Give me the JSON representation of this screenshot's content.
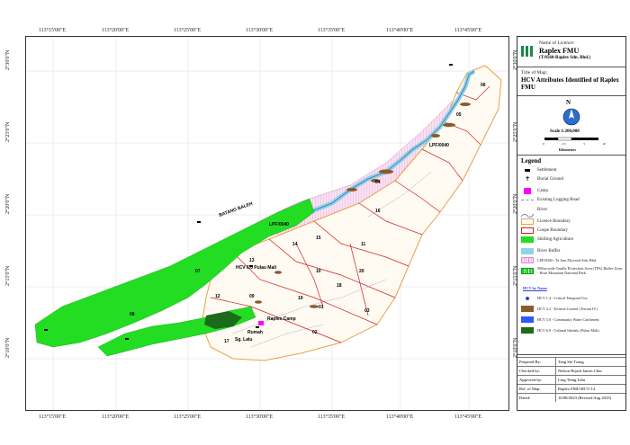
{
  "grid": {
    "top_ticks": [
      "113°15'00\"E",
      "113°20'00\"E",
      "113°25'00\"E",
      "113°30'00\"E",
      "113°35'00\"E",
      "113°40'00\"E",
      "113°45'00\"E"
    ],
    "left_ticks": [
      "2°30'0\"N",
      "2°25'0\"N",
      "2°20'0\"N",
      "2°15'0\"N",
      "2°10'0\"N"
    ]
  },
  "licence": {
    "heading": "Name of Licence:",
    "name": "Raplex FMU",
    "code": "(T/0560-Raplex Sdn. Bhd.)"
  },
  "title_block": {
    "heading": "Title of Map:",
    "title": "HCV Attributes Identified of Raplex FMU"
  },
  "north": {
    "letter": "N"
  },
  "scale": {
    "text": "Scale 1:200,000",
    "units": "Kilometers",
    "ticks": [
      "0",
      "2.5",
      "5",
      "10"
    ]
  },
  "legend": {
    "heading": "Legend",
    "items": [
      {
        "label": "Settlement",
        "icon": "settlement-icon"
      },
      {
        "label": "Burial Ground",
        "icon": "burial-icon"
      },
      {
        "label": "Camp",
        "icon": "camp-icon",
        "color": "#ff00ff"
      },
      {
        "label": "Existing Logging Road",
        "icon": "road-icon"
      },
      {
        "label": "River",
        "icon": "river-icon"
      },
      {
        "label": "Licence Boundary",
        "icon": "licence-boundary-icon",
        "color": "#e8a24a"
      },
      {
        "label": "Coupe Boundary",
        "icon": "coupe-boundary-icon",
        "color": "#d02020"
      },
      {
        "label": "Shifting Agriculture",
        "icon": "agriculture-icon",
        "color": "#22dd22"
      },
      {
        "label": "River Buffer",
        "icon": "river-buffer-icon",
        "color": "#8fd3e8"
      },
      {
        "label": "LPF/0040 - Ta Ann Plywood Sdn. Bhd.",
        "icon": "lpf-icon",
        "color": "#f4c0e8"
      },
      {
        "label": "500m-wide Totally Protection Area (TPA) Buffer Zone - Hose Mountain National Park",
        "icon": "tpa-icon",
        "color": "#22cc22"
      }
    ],
    "hcv_heading": "HCV by Name",
    "hcv_items": [
      {
        "label": "HCV 1.4 - Critical Temporal Use",
        "icon": "hcv14-icon",
        "color": "#3344cc"
      },
      {
        "label": "HCV 4.2 - Erosion Control (Terrain IV)",
        "icon": "hcv42-icon",
        "color": "#8b5a2b"
      },
      {
        "label": "HCV 5.0 - Community Water Catchment",
        "icon": "hcv50-icon",
        "color": "#3355ff"
      },
      {
        "label": "HCV 6.0 - Cultural Identity (Pulau Mali)",
        "icon": "hcv60-icon",
        "color": "#1b6b1b"
      }
    ]
  },
  "info": [
    {
      "key": "Prepared By:",
      "value": "Tang Sie Tzang"
    },
    {
      "key": "Checked by:",
      "value": "Nelson Bijack James Chin"
    },
    {
      "key": "Approved by:",
      "value": "Ling Tieng Lihu"
    },
    {
      "key": "Ref. of Map:",
      "value": "Raplex FMU/HCV/14"
    },
    {
      "key": "Dated:",
      "value": "10/08/2023 (Revised Aug 2023)"
    }
  ],
  "map_labels": {
    "lpf_label_1": "LPF/0040",
    "lpf_label_2": "LPF/0040",
    "river_name": "BATANG BALEH",
    "coupes": [
      "06",
      "05",
      "04",
      "16",
      "15",
      "14",
      "13",
      "11",
      "10",
      "09",
      "20",
      "12",
      "07",
      "08",
      "17",
      "19",
      "01",
      "02",
      "03",
      "18"
    ],
    "camp_label": "Raplex Camp",
    "place_label_1": "HCV 6.0 Pulau Mali",
    "place_label_2": "Rumah",
    "place_label_3": "Sg. Lalu"
  }
}
